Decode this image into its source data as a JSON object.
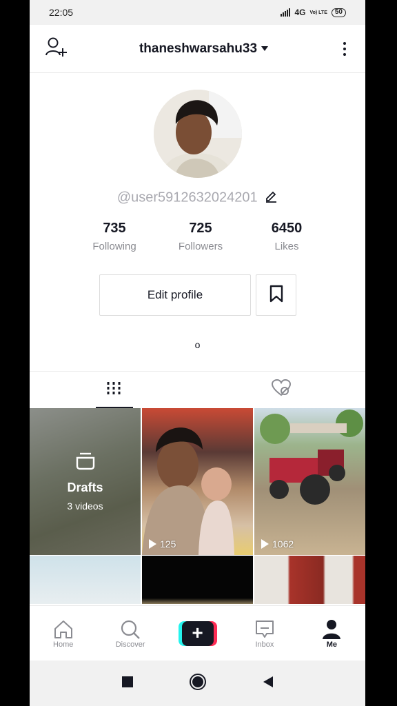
{
  "status_bar": {
    "time": "22:05",
    "network": "4G",
    "volte": "Vo) LTE",
    "battery": "50"
  },
  "header": {
    "username": "thaneshwarsahu33"
  },
  "profile": {
    "handle": "@user5912632024201",
    "bio": "o",
    "stats": [
      {
        "value": "735",
        "label": "Following"
      },
      {
        "value": "725",
        "label": "Followers"
      },
      {
        "value": "6450",
        "label": "Likes"
      }
    ],
    "edit_profile_label": "Edit profile"
  },
  "grid": {
    "drafts": {
      "title": "Drafts",
      "count": "3 videos"
    },
    "videos": [
      {
        "plays": "125"
      },
      {
        "plays": "1062"
      }
    ]
  },
  "bottom_nav": {
    "items": [
      {
        "label": "Home"
      },
      {
        "label": "Discover"
      },
      {
        "label": ""
      },
      {
        "label": "Inbox"
      },
      {
        "label": "Me"
      }
    ]
  },
  "colors": {
    "accent_cyan": "#25f4ee",
    "accent_red": "#fe2c55",
    "text_primary": "#161823",
    "text_secondary": "#8a8b91"
  }
}
